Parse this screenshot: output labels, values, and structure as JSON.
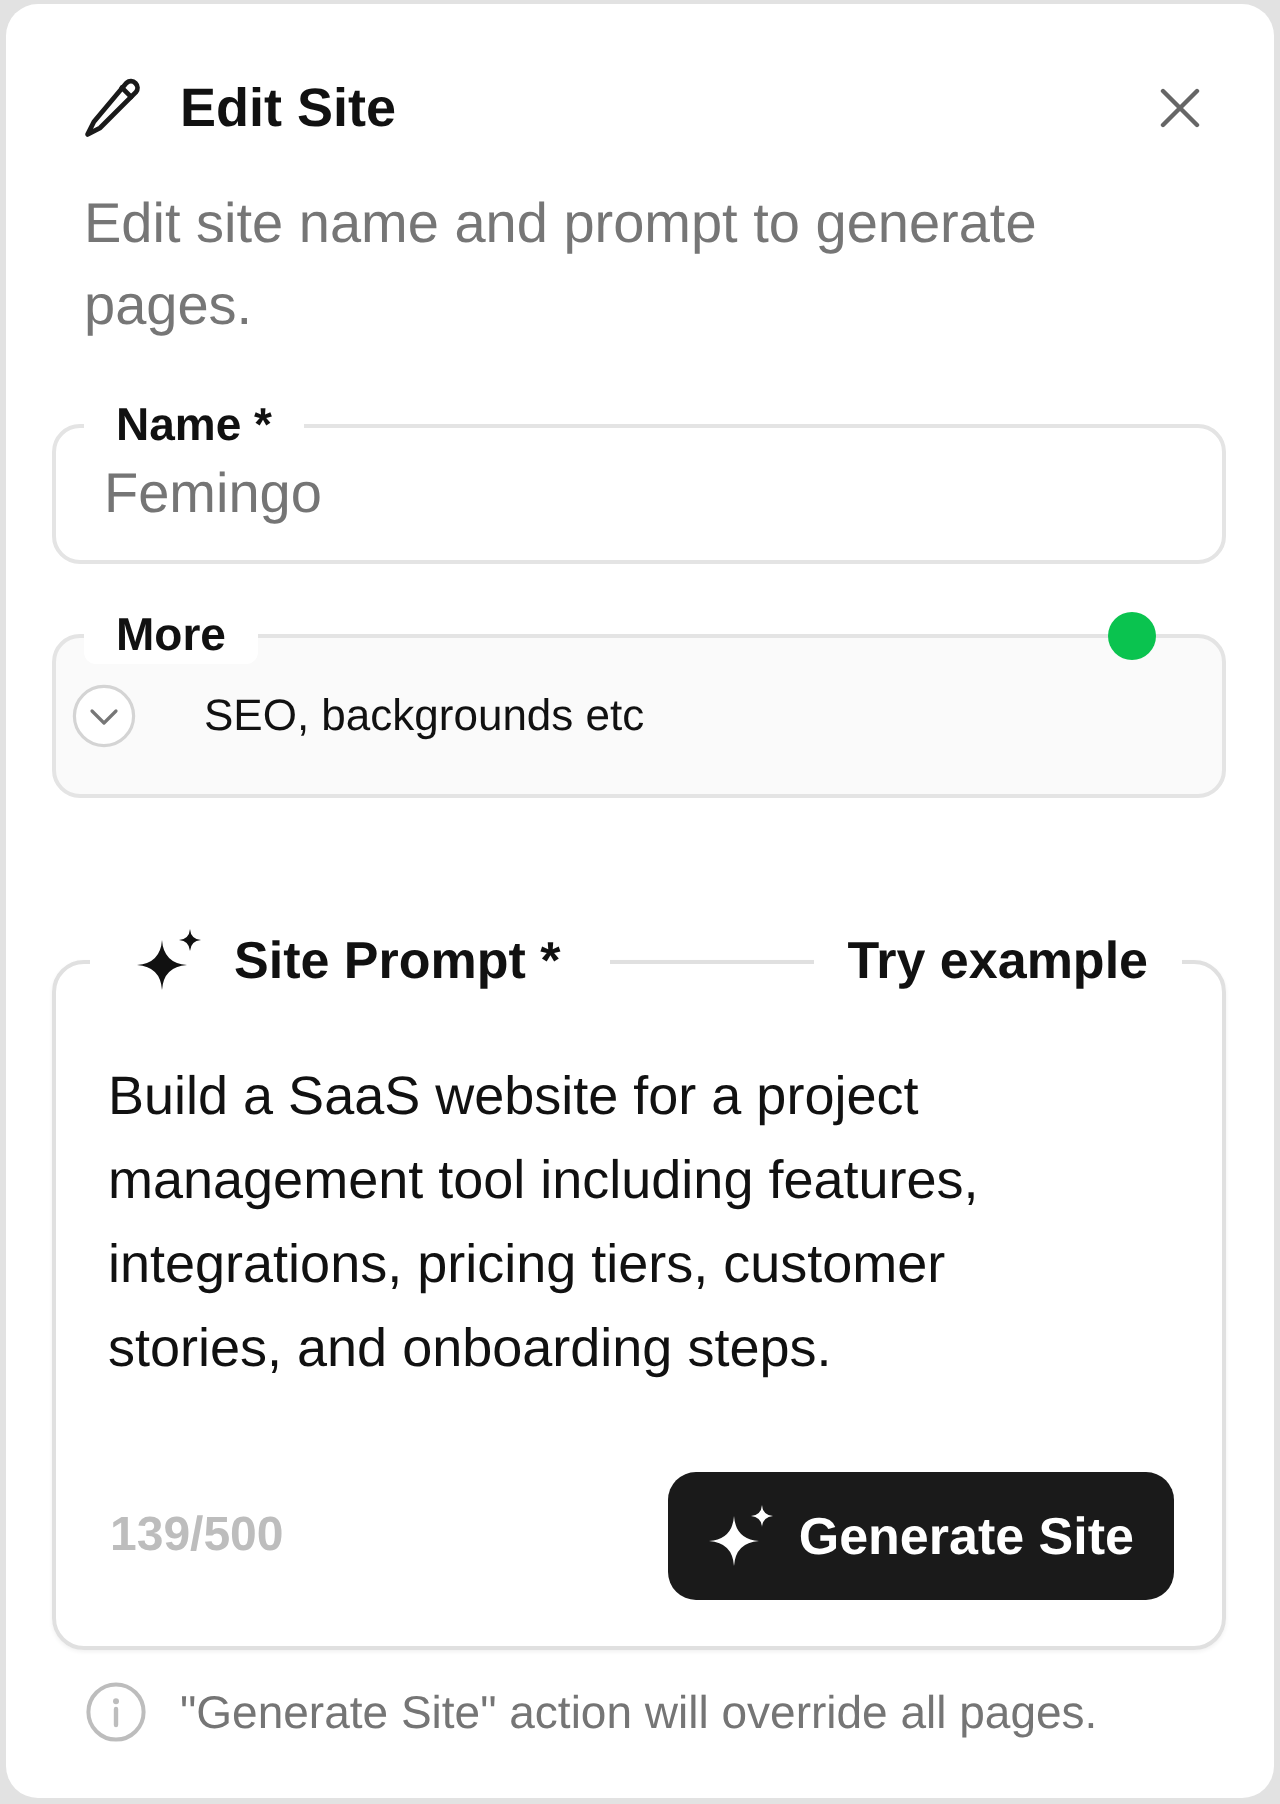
{
  "dialog": {
    "title": "Edit Site",
    "subtitle": "Edit site name and prompt to generate pages."
  },
  "name_field": {
    "label": "Name *",
    "value": "Femingo"
  },
  "more_section": {
    "label": "More",
    "summary": "SEO, backgrounds etc",
    "expanded": false,
    "indicator": true
  },
  "prompt_field": {
    "label": "Site Prompt *",
    "example_link": "Try example",
    "value": "Build a SaaS website for a project management tool including features, integrations, pricing tiers, customer stories, and onboarding steps.",
    "counter": "139/500",
    "button": "Generate Site"
  },
  "note": "\"Generate Site\" action will override all pages."
}
